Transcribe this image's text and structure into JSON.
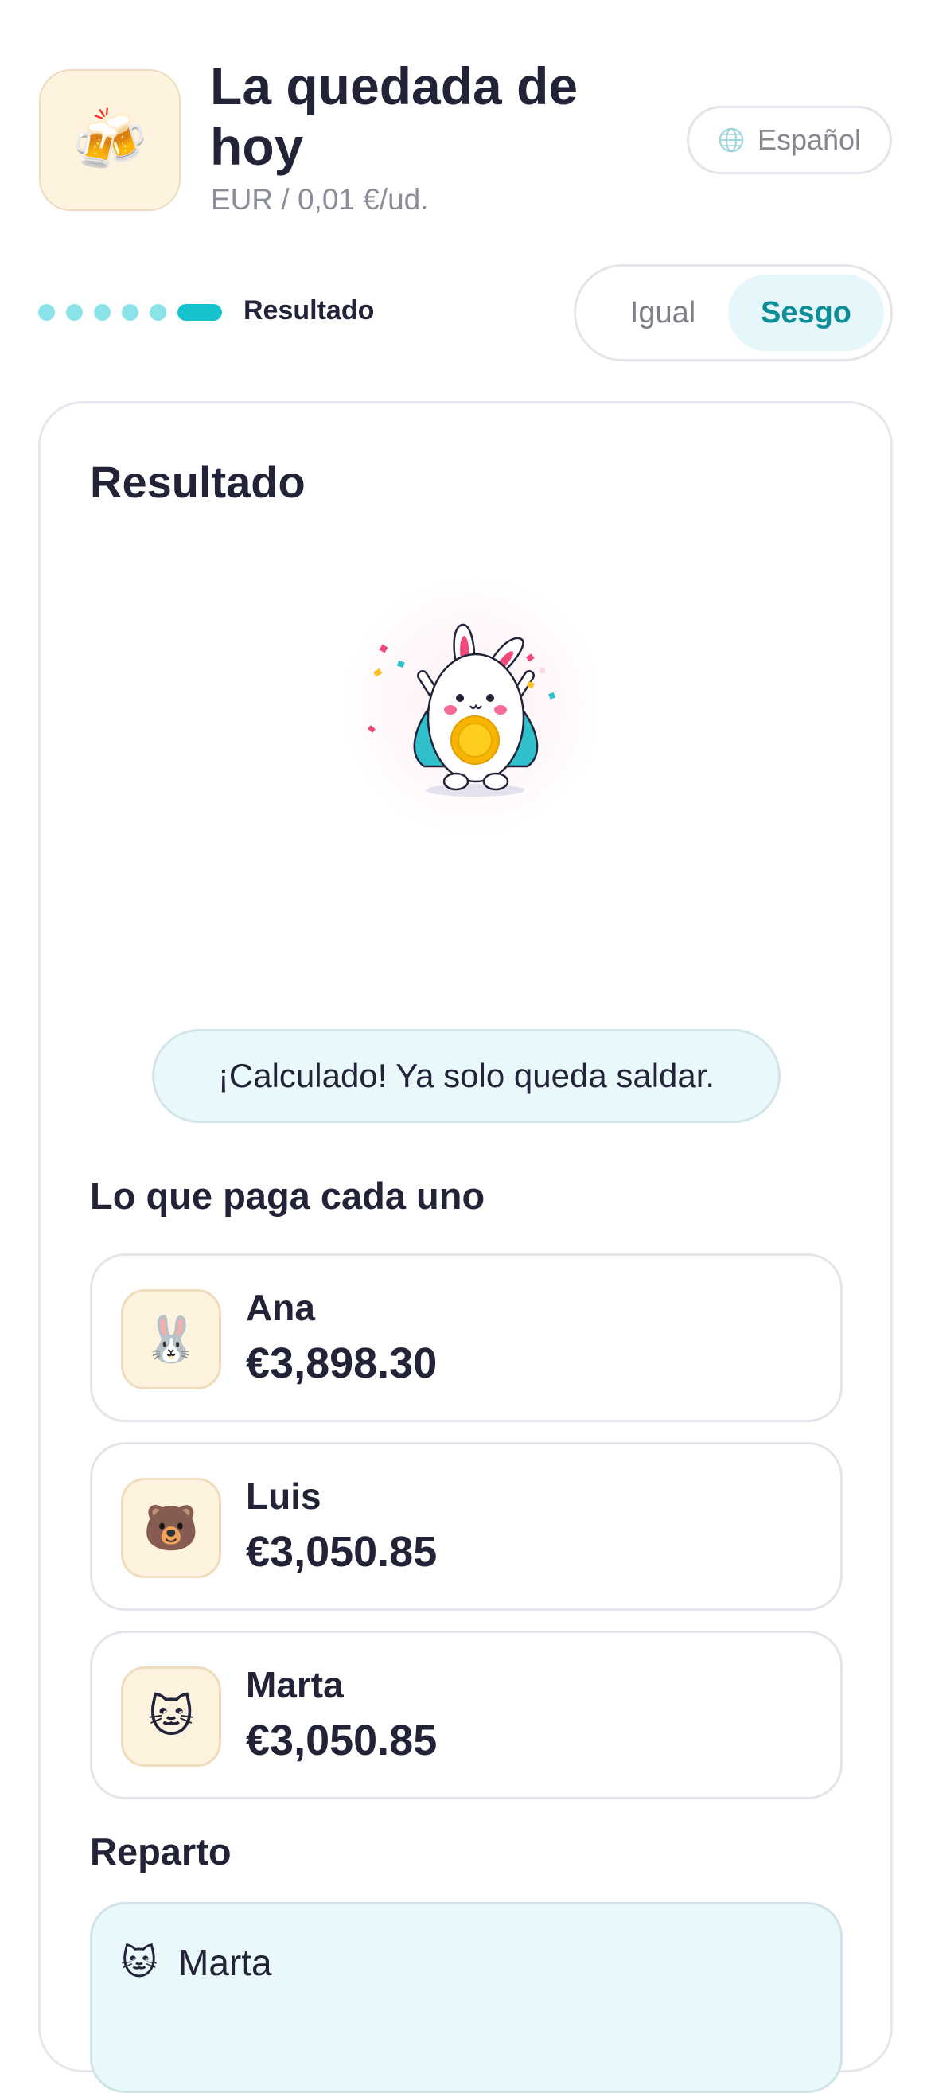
{
  "header": {
    "app_icon": "beer-mugs-icon",
    "app_emoji": "🍻",
    "title": "La quedada de hoy",
    "subtitle": "EUR / 0,01 €/ud.",
    "language_label": "Español"
  },
  "progress": {
    "step_label": "Resultado",
    "total_steps": 6,
    "current_step": 6
  },
  "mode_toggle": {
    "options": [
      "Igual",
      "Sesgo"
    ],
    "selected": "Sesgo"
  },
  "result": {
    "title": "Resultado",
    "message": "¡Calculado! Ya solo queda saldar.",
    "per_person_title": "Lo que paga cada uno",
    "people": [
      {
        "emoji": "🐰",
        "icon": "rabbit-avatar-icon",
        "name": "Ana",
        "amount": "€3,898.30"
      },
      {
        "emoji": "🐻",
        "icon": "bear-avatar-icon",
        "name": "Luis",
        "amount": "€3,050.85"
      },
      {
        "emoji": "🐱",
        "icon": "cat-avatar-icon",
        "name": "Marta",
        "amount": "€3,050.85"
      }
    ],
    "split_title": "Reparto",
    "split_first": {
      "emoji": "🐱",
      "name": "Marta"
    }
  },
  "colors": {
    "accent": "#15c3cf",
    "accent_light": "#8be3ea",
    "toggle_active_bg": "#e5f7fa",
    "toggle_active_text": "#0c8e98",
    "avatar_bg": "#fef3df",
    "message_bg": "#e9f8fb"
  }
}
